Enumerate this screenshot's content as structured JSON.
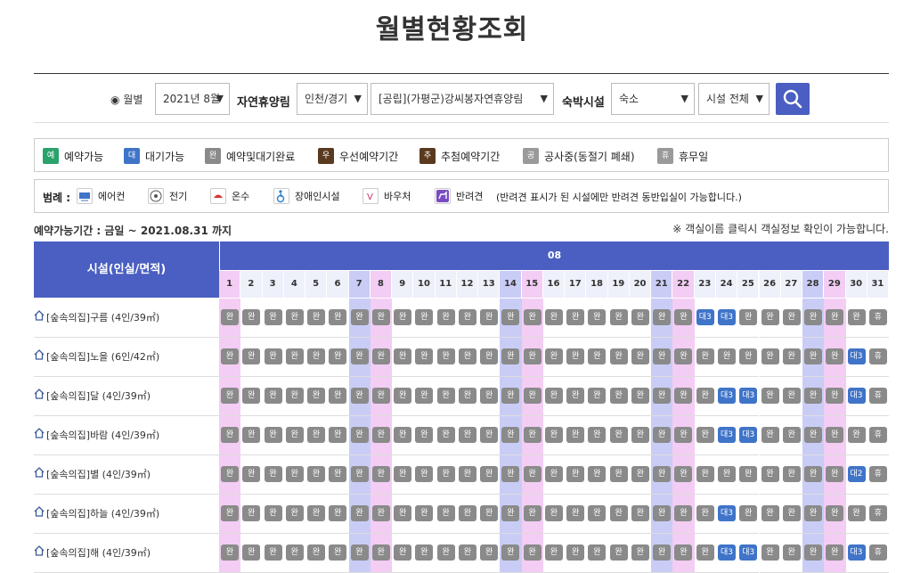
{
  "page": {
    "title": "월별현황조회"
  },
  "search": {
    "radio_label": "월별",
    "month_select": "2021년 8월",
    "forest_label": "자연휴양림",
    "region_select": "인천/경기",
    "forest_select": "[공립](가평군)강씨봉자연휴양림",
    "facility_label": "숙박시설",
    "facility_type_select": "숙소",
    "facility_all_select": "시설 전체"
  },
  "status_legend": [
    {
      "code": "예",
      "label": "예약가능",
      "color": "#2aa36b"
    },
    {
      "code": "대",
      "label": "대기가능",
      "color": "#3f74c8"
    },
    {
      "code": "완",
      "label": "예약및대기완료",
      "color": "#8a8a8a"
    },
    {
      "code": "우",
      "label": "우선예약기간",
      "color": "#5a3a1e"
    },
    {
      "code": "추",
      "label": "추첨예약기간",
      "color": "#5a3a1e"
    },
    {
      "code": "공",
      "label": "공사중(동절기 폐쇄)",
      "color": "#9a9a9a"
    },
    {
      "code": "휴",
      "label": "휴무일",
      "color": "#9a9a9a"
    }
  ],
  "amenity_legend": {
    "title": "범례 :",
    "items": [
      {
        "icon": "air-conditioner-icon",
        "label": "에어컨"
      },
      {
        "icon": "power-outlet-icon",
        "label": "전기"
      },
      {
        "icon": "hot-water-icon",
        "label": "온수"
      },
      {
        "icon": "wheelchair-icon",
        "label": "장애인시설"
      },
      {
        "icon": "voucher-icon",
        "label": "바우처"
      },
      {
        "icon": "pet-icon",
        "label": "반려견"
      }
    ],
    "note": "(반려견 표시가 된 시설에만 반려견 동반입실이 가능합니다.)"
  },
  "period_text": "예약가능기간 : 금일 ~ 2021.08.31 까지",
  "info_note": "※ 객실이름 클릭시 객실정보 확인이 가능합니다.",
  "table": {
    "facility_header": "시설(인실/면적)",
    "month": "08",
    "days": [
      "1",
      "2",
      "3",
      "4",
      "5",
      "6",
      "7",
      "8",
      "9",
      "10",
      "11",
      "12",
      "13",
      "14",
      "15",
      "16",
      "17",
      "18",
      "19",
      "20",
      "21",
      "22",
      "23",
      "24",
      "25",
      "26",
      "27",
      "28",
      "29",
      "30",
      "31"
    ],
    "saturdays": [
      7,
      14,
      21,
      28
    ],
    "sundays": [
      1,
      8,
      15,
      22,
      29
    ],
    "rows": [
      {
        "name": "[숲속의집]구름 (4인/39㎡)",
        "cells": [
          "완",
          "완",
          "완",
          "완",
          "완",
          "완",
          "완",
          "완",
          "완",
          "완",
          "완",
          "완",
          "완",
          "완",
          "완",
          "완",
          "완",
          "완",
          "완",
          "완",
          "완",
          "완",
          "대3",
          "대3",
          "완",
          "완",
          "완",
          "완",
          "완",
          "완",
          "휴"
        ]
      },
      {
        "name": "[숲속의집]노을 (6인/42㎡)",
        "cells": [
          "완",
          "완",
          "완",
          "완",
          "완",
          "완",
          "완",
          "완",
          "완",
          "완",
          "완",
          "완",
          "완",
          "완",
          "완",
          "완",
          "완",
          "완",
          "완",
          "완",
          "완",
          "완",
          "완",
          "완",
          "완",
          "완",
          "완",
          "완",
          "완",
          "대3",
          "휴"
        ]
      },
      {
        "name": "[숲속의집]달 (4인/39㎡)",
        "cells": [
          "완",
          "완",
          "완",
          "완",
          "완",
          "완",
          "완",
          "완",
          "완",
          "완",
          "완",
          "완",
          "완",
          "완",
          "완",
          "완",
          "완",
          "완",
          "완",
          "완",
          "완",
          "완",
          "완",
          "대3",
          "대3",
          "완",
          "완",
          "완",
          "완",
          "대3",
          "휴"
        ]
      },
      {
        "name": "[숲속의집]바람 (4인/39㎡)",
        "cells": [
          "완",
          "완",
          "완",
          "완",
          "완",
          "완",
          "완",
          "완",
          "완",
          "완",
          "완",
          "완",
          "완",
          "완",
          "완",
          "완",
          "완",
          "완",
          "완",
          "완",
          "완",
          "완",
          "완",
          "대3",
          "대3",
          "완",
          "완",
          "완",
          "완",
          "완",
          "휴"
        ]
      },
      {
        "name": "[숲속의집]별 (4인/39㎡)",
        "cells": [
          "완",
          "완",
          "완",
          "완",
          "완",
          "완",
          "완",
          "완",
          "완",
          "완",
          "완",
          "완",
          "완",
          "완",
          "완",
          "완",
          "완",
          "완",
          "완",
          "완",
          "완",
          "완",
          "완",
          "완",
          "완",
          "완",
          "완",
          "완",
          "완",
          "대2",
          "휴"
        ]
      },
      {
        "name": "[숲속의집]하늘 (4인/39㎡)",
        "cells": [
          "완",
          "완",
          "완",
          "완",
          "완",
          "완",
          "완",
          "완",
          "완",
          "완",
          "완",
          "완",
          "완",
          "완",
          "완",
          "완",
          "완",
          "완",
          "완",
          "완",
          "완",
          "완",
          "완",
          "대3",
          "완",
          "완",
          "완",
          "완",
          "완",
          "완",
          "휴"
        ]
      },
      {
        "name": "[숲속의집]해 (4인/39㎡)",
        "cells": [
          "완",
          "완",
          "완",
          "완",
          "완",
          "완",
          "완",
          "완",
          "완",
          "완",
          "완",
          "완",
          "완",
          "완",
          "완",
          "완",
          "완",
          "완",
          "완",
          "완",
          "완",
          "완",
          "완",
          "대3",
          "대3",
          "완",
          "완",
          "완",
          "완",
          "대3",
          "휴"
        ]
      }
    ]
  },
  "colors": {
    "header_blue": "#4a5fc1",
    "saturday_bg": "#c9cdf6",
    "sunday_bg": "#f3cdf3",
    "badge_full": "#8a8a8a",
    "badge_wait": "#3f74c8",
    "badge_closed": "#8a8a8a"
  }
}
